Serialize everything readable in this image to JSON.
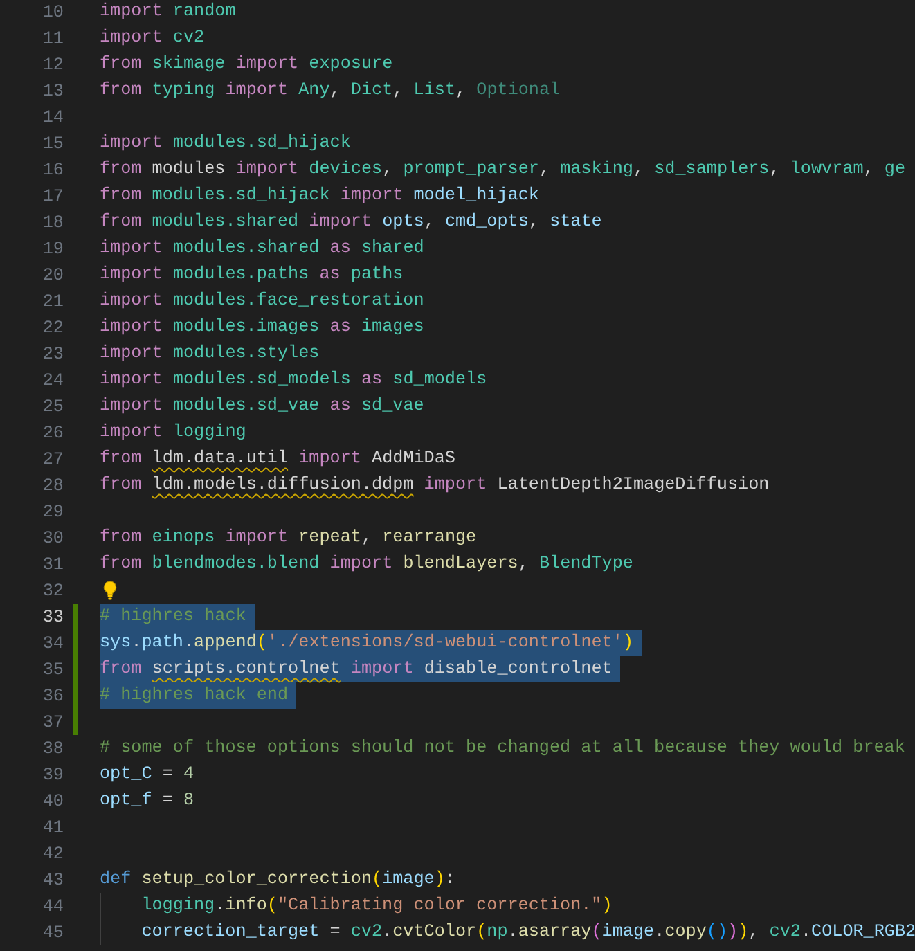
{
  "editor": {
    "lines": [
      {
        "n": "10",
        "selected": false,
        "modified": false,
        "current": false,
        "tokens": [
          {
            "t": "import ",
            "kind": "kw"
          },
          {
            "t": "random",
            "kind": "mod"
          }
        ]
      },
      {
        "n": "11",
        "selected": false,
        "modified": false,
        "current": false,
        "tokens": [
          {
            "t": "import ",
            "kind": "kw"
          },
          {
            "t": "cv2",
            "kind": "mod"
          }
        ]
      },
      {
        "n": "12",
        "selected": false,
        "modified": false,
        "current": false,
        "tokens": [
          {
            "t": "from ",
            "kind": "kw"
          },
          {
            "t": "skimage ",
            "kind": "mod"
          },
          {
            "t": "import ",
            "kind": "kw"
          },
          {
            "t": "exposure",
            "kind": "mod"
          }
        ]
      },
      {
        "n": "13",
        "selected": false,
        "modified": false,
        "current": false,
        "tokens": [
          {
            "t": "from ",
            "kind": "kw"
          },
          {
            "t": "typing ",
            "kind": "mod"
          },
          {
            "t": "import ",
            "kind": "kw"
          },
          {
            "t": "Any",
            "kind": "mod"
          },
          {
            "t": ", ",
            "kind": "p"
          },
          {
            "t": "Dict",
            "kind": "mod"
          },
          {
            "t": ", ",
            "kind": "p"
          },
          {
            "t": "List",
            "kind": "mod"
          },
          {
            "t": ", ",
            "kind": "p"
          },
          {
            "t": "Optional",
            "kind": "unused"
          }
        ]
      },
      {
        "n": "14",
        "selected": false,
        "modified": false,
        "current": false
      },
      {
        "n": "15",
        "selected": false,
        "modified": false,
        "current": false,
        "tokens": [
          {
            "t": "import ",
            "kind": "kw"
          },
          {
            "t": "modules.sd_hijack",
            "kind": "mod"
          }
        ]
      },
      {
        "n": "16",
        "selected": false,
        "modified": false,
        "current": false,
        "tokens": [
          {
            "t": "from ",
            "kind": "kw"
          },
          {
            "t": "modules ",
            "kind": "p"
          },
          {
            "t": "import ",
            "kind": "kw"
          },
          {
            "t": "devices",
            "kind": "mod"
          },
          {
            "t": ", ",
            "kind": "p"
          },
          {
            "t": "prompt_parser",
            "kind": "mod"
          },
          {
            "t": ", ",
            "kind": "p"
          },
          {
            "t": "masking",
            "kind": "mod"
          },
          {
            "t": ", ",
            "kind": "p"
          },
          {
            "t": "sd_samplers",
            "kind": "mod"
          },
          {
            "t": ", ",
            "kind": "p"
          },
          {
            "t": "lowvram",
            "kind": "mod"
          },
          {
            "t": ", ",
            "kind": "p"
          },
          {
            "t": "ge",
            "kind": "mod"
          }
        ]
      },
      {
        "n": "17",
        "selected": false,
        "modified": false,
        "current": false,
        "tokens": [
          {
            "t": "from ",
            "kind": "kw"
          },
          {
            "t": "modules.sd_hijack ",
            "kind": "mod"
          },
          {
            "t": "import ",
            "kind": "kw"
          },
          {
            "t": "model_hijack",
            "kind": "var"
          }
        ]
      },
      {
        "n": "18",
        "selected": false,
        "modified": false,
        "current": false,
        "tokens": [
          {
            "t": "from ",
            "kind": "kw"
          },
          {
            "t": "modules.shared ",
            "kind": "mod"
          },
          {
            "t": "import ",
            "kind": "kw"
          },
          {
            "t": "opts",
            "kind": "var"
          },
          {
            "t": ", ",
            "kind": "p"
          },
          {
            "t": "cmd_opts",
            "kind": "var"
          },
          {
            "t": ", ",
            "kind": "p"
          },
          {
            "t": "state",
            "kind": "var"
          }
        ]
      },
      {
        "n": "19",
        "selected": false,
        "modified": false,
        "current": false,
        "tokens": [
          {
            "t": "import ",
            "kind": "kw"
          },
          {
            "t": "modules.shared ",
            "kind": "mod"
          },
          {
            "t": "as ",
            "kind": "kw"
          },
          {
            "t": "shared",
            "kind": "mod"
          }
        ]
      },
      {
        "n": "20",
        "selected": false,
        "modified": false,
        "current": false,
        "tokens": [
          {
            "t": "import ",
            "kind": "kw"
          },
          {
            "t": "modules.paths ",
            "kind": "mod"
          },
          {
            "t": "as ",
            "kind": "kw"
          },
          {
            "t": "paths",
            "kind": "mod"
          }
        ]
      },
      {
        "n": "21",
        "selected": false,
        "modified": false,
        "current": false,
        "tokens": [
          {
            "t": "import ",
            "kind": "kw"
          },
          {
            "t": "modules.face_restoration",
            "kind": "mod"
          }
        ]
      },
      {
        "n": "22",
        "selected": false,
        "modified": false,
        "current": false,
        "tokens": [
          {
            "t": "import ",
            "kind": "kw"
          },
          {
            "t": "modules.images ",
            "kind": "mod"
          },
          {
            "t": "as ",
            "kind": "kw"
          },
          {
            "t": "images",
            "kind": "mod"
          }
        ]
      },
      {
        "n": "23",
        "selected": false,
        "modified": false,
        "current": false,
        "tokens": [
          {
            "t": "import ",
            "kind": "kw"
          },
          {
            "t": "modules.styles",
            "kind": "mod"
          }
        ]
      },
      {
        "n": "24",
        "selected": false,
        "modified": false,
        "current": false,
        "tokens": [
          {
            "t": "import ",
            "kind": "kw"
          },
          {
            "t": "modules.sd_models ",
            "kind": "mod"
          },
          {
            "t": "as ",
            "kind": "kw"
          },
          {
            "t": "sd_models",
            "kind": "mod"
          }
        ]
      },
      {
        "n": "25",
        "selected": false,
        "modified": false,
        "current": false,
        "tokens": [
          {
            "t": "import ",
            "kind": "kw"
          },
          {
            "t": "modules.sd_vae ",
            "kind": "mod"
          },
          {
            "t": "as ",
            "kind": "kw"
          },
          {
            "t": "sd_vae",
            "kind": "mod"
          }
        ]
      },
      {
        "n": "26",
        "selected": false,
        "modified": false,
        "current": false,
        "tokens": [
          {
            "t": "import ",
            "kind": "kw"
          },
          {
            "t": "logging",
            "kind": "mod"
          }
        ]
      },
      {
        "n": "27",
        "selected": false,
        "modified": false,
        "current": false,
        "tokens": [
          {
            "t": "from ",
            "kind": "kw"
          },
          {
            "t": "ldm.data.util",
            "kind": "unresolved"
          },
          {
            "t": " import ",
            "kind": "kw"
          },
          {
            "t": "AddMiDaS",
            "kind": "p"
          }
        ]
      },
      {
        "n": "28",
        "selected": false,
        "modified": false,
        "current": false,
        "tokens": [
          {
            "t": "from ",
            "kind": "kw"
          },
          {
            "t": "ldm.models.diffusion.ddpm",
            "kind": "unresolved"
          },
          {
            "t": " import ",
            "kind": "kw"
          },
          {
            "t": "LatentDepth2ImageDiffusion",
            "kind": "p"
          }
        ]
      },
      {
        "n": "29",
        "selected": false,
        "modified": false,
        "current": false
      },
      {
        "n": "30",
        "selected": false,
        "modified": false,
        "current": false,
        "tokens": [
          {
            "t": "from ",
            "kind": "kw"
          },
          {
            "t": "einops ",
            "kind": "mod"
          },
          {
            "t": "import ",
            "kind": "kw"
          },
          {
            "t": "repeat",
            "kind": "fn"
          },
          {
            "t": ", ",
            "kind": "p"
          },
          {
            "t": "rearrange",
            "kind": "fn"
          }
        ]
      },
      {
        "n": "31",
        "selected": false,
        "modified": false,
        "current": false,
        "tokens": [
          {
            "t": "from ",
            "kind": "kw"
          },
          {
            "t": "blendmodes.blend ",
            "kind": "mod"
          },
          {
            "t": "import ",
            "kind": "kw"
          },
          {
            "t": "blendLayers",
            "kind": "fn"
          },
          {
            "t": ", ",
            "kind": "p"
          },
          {
            "t": "BlendType",
            "kind": "mod"
          }
        ]
      },
      {
        "n": "32",
        "selected": false,
        "modified": false,
        "current": false,
        "tokens": [
          {
            "kind": "bulb"
          }
        ]
      },
      {
        "n": "33",
        "selected": true,
        "modified": true,
        "current": true,
        "tokens": [
          {
            "t": "# highres hack",
            "kind": "comment"
          }
        ]
      },
      {
        "n": "34",
        "selected": true,
        "modified": true,
        "current": false,
        "tokens": [
          {
            "t": "sys",
            "kind": "var"
          },
          {
            "t": ".",
            "kind": "p"
          },
          {
            "t": "path",
            "kind": "var"
          },
          {
            "t": ".",
            "kind": "p"
          },
          {
            "t": "append",
            "kind": "fn"
          },
          {
            "t": "(",
            "kind": "b1"
          },
          {
            "t": "'./extensions/sd-webui-controlnet'",
            "kind": "str"
          },
          {
            "t": ")",
            "kind": "b1"
          }
        ]
      },
      {
        "n": "35",
        "selected": true,
        "modified": true,
        "current": false,
        "tokens": [
          {
            "t": "from ",
            "kind": "kw"
          },
          {
            "t": "scripts.controlnet",
            "kind": "unresolved"
          },
          {
            "t": " import ",
            "kind": "kw"
          },
          {
            "t": "disable_controlnet",
            "kind": "p"
          }
        ]
      },
      {
        "n": "36",
        "selected": true,
        "modified": true,
        "current": false,
        "tokens": [
          {
            "t": "# highres hack end",
            "kind": "comment"
          }
        ]
      },
      {
        "n": "37",
        "selected": false,
        "modified": true,
        "current": false
      },
      {
        "n": "38",
        "selected": false,
        "modified": false,
        "current": false,
        "tokens": [
          {
            "t": "# some of those options should not be changed at all because they would break",
            "kind": "comment"
          }
        ]
      },
      {
        "n": "39",
        "selected": false,
        "modified": false,
        "current": false,
        "tokens": [
          {
            "t": "opt_C",
            "kind": "var"
          },
          {
            "t": " = ",
            "kind": "p"
          },
          {
            "t": "4",
            "kind": "num"
          }
        ]
      },
      {
        "n": "40",
        "selected": false,
        "modified": false,
        "current": false,
        "tokens": [
          {
            "t": "opt_f",
            "kind": "var"
          },
          {
            "t": " = ",
            "kind": "p"
          },
          {
            "t": "8",
            "kind": "num"
          }
        ]
      },
      {
        "n": "41",
        "selected": false,
        "modified": false,
        "current": false
      },
      {
        "n": "42",
        "selected": false,
        "modified": false,
        "current": false
      },
      {
        "n": "43",
        "selected": false,
        "modified": false,
        "current": false,
        "tokens": [
          {
            "t": "def ",
            "kind": "def"
          },
          {
            "t": "setup_color_correction",
            "kind": "fn"
          },
          {
            "t": "(",
            "kind": "b1"
          },
          {
            "t": "image",
            "kind": "var"
          },
          {
            "t": ")",
            "kind": "b1"
          },
          {
            "t": ":",
            "kind": "p"
          }
        ],
        "children": [
          {
            "n": "44",
            "selected": false,
            "modified": false,
            "current": false,
            "tokens": [
              {
                "t": "logging",
                "kind": "mod"
              },
              {
                "t": ".",
                "kind": "p"
              },
              {
                "t": "info",
                "kind": "fn"
              },
              {
                "t": "(",
                "kind": "b1"
              },
              {
                "t": "\"Calibrating color correction.\"",
                "kind": "str"
              },
              {
                "t": ")",
                "kind": "b1"
              }
            ]
          },
          {
            "n": "45",
            "selected": false,
            "modified": false,
            "current": false,
            "tokens": [
              {
                "t": "correction_target",
                "kind": "var"
              },
              {
                "t": " = ",
                "kind": "p"
              },
              {
                "t": "cv2",
                "kind": "mod"
              },
              {
                "t": ".",
                "kind": "p"
              },
              {
                "t": "cvtColor",
                "kind": "fn"
              },
              {
                "t": "(",
                "kind": "b1"
              },
              {
                "t": "np",
                "kind": "mod"
              },
              {
                "t": ".",
                "kind": "p"
              },
              {
                "t": "asarray",
                "kind": "fn"
              },
              {
                "t": "(",
                "kind": "b2"
              },
              {
                "t": "image",
                "kind": "var"
              },
              {
                "t": ".",
                "kind": "p"
              },
              {
                "t": "copy",
                "kind": "fn"
              },
              {
                "t": "()",
                "kind": "b3"
              },
              {
                "t": ")",
                "kind": "b2"
              },
              {
                "t": ")",
                "kind": "b1"
              },
              {
                "t": ", ",
                "kind": "p"
              },
              {
                "t": "cv2",
                "kind": "mod"
              },
              {
                "t": ".",
                "kind": "p"
              },
              {
                "t": "COLOR_RGB2",
                "kind": "var"
              }
            ]
          }
        ]
      }
    ]
  }
}
